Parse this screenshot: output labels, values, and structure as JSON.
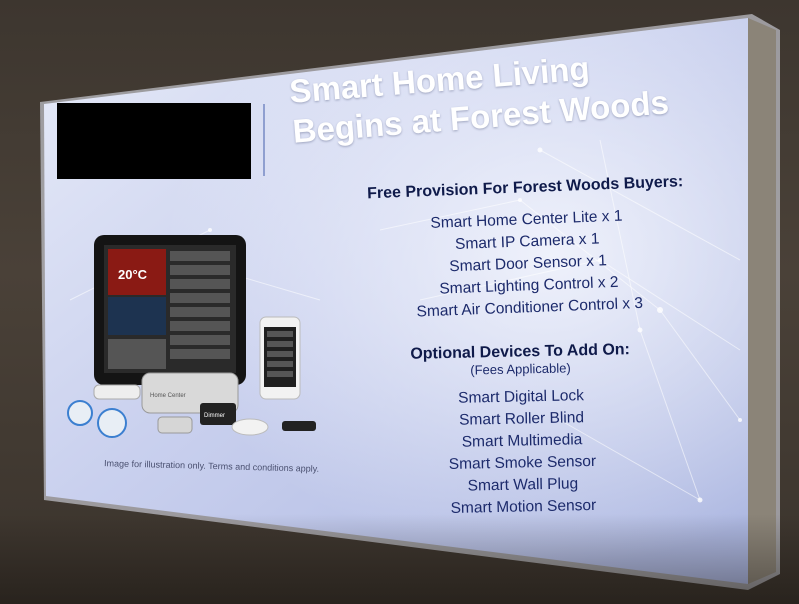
{
  "title": {
    "line1": "Smart Home Living",
    "line2": "Begins at Forest Woods"
  },
  "free_section": {
    "heading": "Free Provision For Forest Woods Buyers:",
    "items": [
      "Smart Home Center Lite x 1",
      "Smart IP Camera x 1",
      "Smart Door Sensor x 1",
      "Smart Lighting Control x 2",
      "Smart Air Conditioner Control x 3"
    ]
  },
  "optional_section": {
    "heading": "Optional Devices To Add On:",
    "note": "(Fees Applicable)",
    "items": [
      "Smart Digital Lock",
      "Smart Roller Blind",
      "Smart Multimedia",
      "Smart Smoke Sensor",
      "Smart Wall Plug",
      "Smart Motion Sensor"
    ]
  },
  "caption": "Image for illustration only. Terms and conditions apply.",
  "device_labels": {
    "thermostat": "20°C",
    "hub": "Home Center",
    "dimmer": "Dimmer"
  },
  "colors": {
    "panel_top": "#dfe4f6",
    "panel_mid": "#b8c1e8",
    "panel_glow": "#eef1fb",
    "text_dark": "#1c2a6b",
    "wall": "#433b33"
  }
}
